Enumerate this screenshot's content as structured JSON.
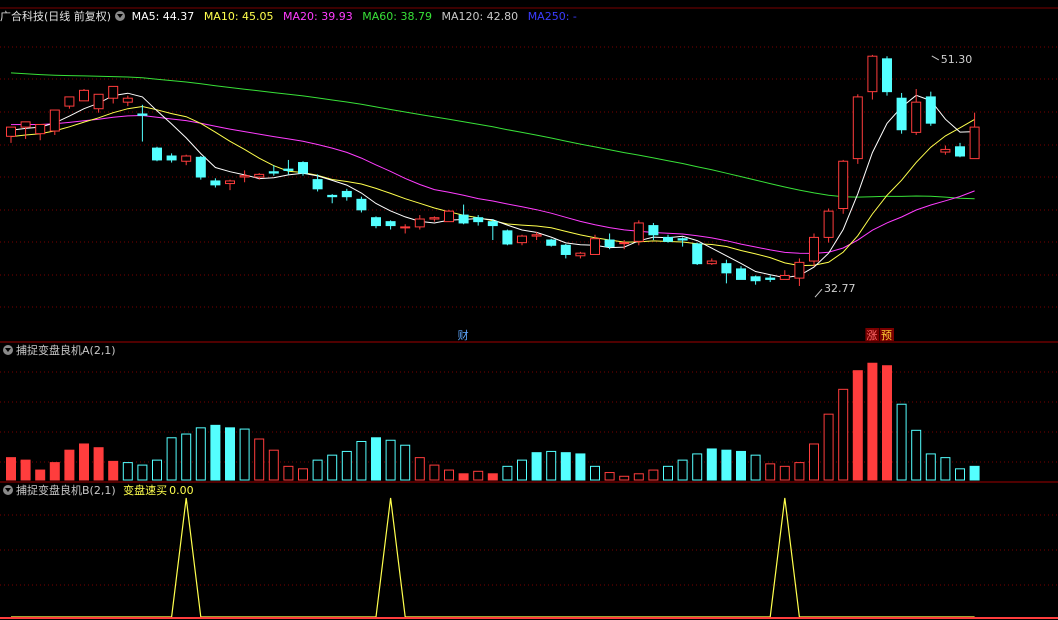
{
  "colors": {
    "up": "#ff3d3d",
    "down": "#54ffff",
    "ma5": "#ffffff",
    "ma10": "#ffff4d",
    "ma20": "#ff3dff",
    "ma60": "#38e038",
    "ma120": "#c8c8c8",
    "ma250": "#3c3cff",
    "signal": "#ffff4d",
    "grid": "#7a0000",
    "separator": "#a00000",
    "text": "#c8c8c8"
  },
  "top_header": {
    "stock_name": "广合科技(日线 前复权)",
    "ma5": "MA5: 44.37",
    "ma10": "MA10: 45.05",
    "ma20": "MA20: 39.93",
    "ma60": "MA60: 38.79",
    "ma120": "MA120: 42.80",
    "ma250": "MA250: -"
  },
  "panel_a": {
    "title": "捕捉变盘良机A(2,1)"
  },
  "panel_b": {
    "title": "捕捉变盘良机B(2,1)",
    "signal_label": "变盘速买",
    "signal_value": "0.00"
  },
  "chart_data": [
    {
      "type": "candlestick",
      "title": "广合科技(日线 前复权)",
      "ylim": [
        30.5,
        53.5
      ],
      "annotations": [
        {
          "text": "51.30",
          "x": 63,
          "value": 51.3
        },
        {
          "text": "32.77",
          "x": 55,
          "value": 32.77
        }
      ],
      "markers": [
        {
          "text": "财",
          "x": 31
        },
        {
          "text": "涨",
          "x": 59
        },
        {
          "text": "预",
          "x": 60
        }
      ],
      "series": [
        {
          "name": "OHLC",
          "ohlc": [
            [
              45.1,
              45.8,
              45.6,
              44.6
            ],
            [
              45.8,
              46.2,
              45.9,
              44.9
            ],
            [
              45.3,
              46.0,
              45.3,
              44.8
            ],
            [
              45.5,
              47.1,
              46.8,
              45.2
            ],
            [
              47.4,
              48.1,
              47.9,
              47.2
            ],
            [
              47.8,
              48.6,
              48.7,
              47.9
            ],
            [
              47.2,
              48.3,
              48.3,
              46.9
            ],
            [
              48.0,
              48.9,
              48.8,
              47.6
            ],
            [
              47.7,
              48.0,
              48.2,
              47.4
            ],
            [
              46.8,
              46.7,
              47.5,
              44.7
            ],
            [
              44.2,
              43.3,
              44.3,
              43.2
            ],
            [
              43.6,
              43.3,
              43.8,
              43.1
            ],
            [
              43.2,
              43.6,
              43.7,
              42.9
            ],
            [
              43.5,
              42.0,
              43.6,
              41.8
            ],
            [
              41.7,
              41.4,
              41.9,
              41.2
            ],
            [
              41.5,
              41.7,
              41.8,
              41.0
            ],
            [
              42.0,
              42.1,
              42.5,
              41.6
            ],
            [
              42.0,
              42.2,
              42.3,
              41.8
            ],
            [
              42.4,
              42.3,
              42.9,
              42.1
            ],
            [
              42.6,
              42.5,
              43.3,
              42.2
            ],
            [
              43.1,
              42.3,
              43.2,
              42.1
            ],
            [
              41.8,
              41.1,
              42.2,
              40.9
            ],
            [
              40.6,
              40.5,
              40.7,
              40.0
            ],
            [
              40.9,
              40.5,
              41.1,
              40.2
            ],
            [
              40.3,
              39.5,
              40.5,
              39.3
            ],
            [
              38.9,
              38.3,
              39.0,
              38.1
            ],
            [
              38.6,
              38.3,
              38.7,
              38.0
            ],
            [
              38.2,
              38.2,
              38.4,
              37.7
            ],
            [
              38.2,
              38.8,
              39.1,
              38.0
            ],
            [
              38.8,
              38.9,
              39.0,
              38.6
            ],
            [
              38.6,
              39.4,
              39.5,
              38.6
            ],
            [
              39.1,
              38.5,
              39.9,
              38.4
            ],
            [
              38.9,
              38.6,
              39.1,
              38.3
            ],
            [
              38.6,
              38.3,
              38.8,
              37.2
            ],
            [
              37.9,
              36.9,
              38.0,
              36.8
            ],
            [
              37.0,
              37.5,
              37.6,
              36.8
            ],
            [
              37.5,
              37.6,
              37.8,
              37.2
            ],
            [
              37.2,
              36.8,
              37.3,
              36.7
            ],
            [
              36.8,
              36.1,
              36.9,
              35.8
            ],
            [
              36.0,
              36.2,
              36.3,
              35.8
            ],
            [
              36.1,
              37.3,
              37.6,
              36.1
            ],
            [
              37.2,
              36.7,
              37.7,
              36.5
            ],
            [
              37.0,
              37.0,
              37.2,
              36.5
            ],
            [
              37.1,
              38.5,
              38.7,
              36.8
            ],
            [
              38.3,
              37.6,
              38.5,
              37.2
            ],
            [
              37.4,
              37.1,
              37.6,
              37.0
            ],
            [
              37.3,
              37.2,
              37.4,
              36.7
            ],
            [
              36.9,
              35.4,
              37.0,
              35.3
            ],
            [
              35.4,
              35.6,
              35.8,
              35.3
            ],
            [
              35.4,
              34.7,
              35.7,
              33.9
            ],
            [
              35.0,
              34.2,
              35.2,
              34.2
            ],
            [
              34.4,
              34.1,
              34.5,
              33.8
            ],
            [
              34.3,
              34.2,
              34.5,
              34.0
            ],
            [
              34.2,
              34.5,
              34.9,
              34.2
            ],
            [
              34.3,
              35.5,
              35.8,
              33.7
            ],
            [
              35.6,
              37.4,
              37.7,
              35.2
            ],
            [
              37.4,
              39.4,
              39.6,
              37.0
            ],
            [
              39.6,
              43.2,
              43.3,
              39.2
            ],
            [
              43.4,
              48.1,
              48.3,
              43.0
            ],
            [
              48.5,
              51.2,
              51.3,
              47.9
            ],
            [
              51.0,
              48.5,
              51.2,
              48.2
            ],
            [
              48.0,
              45.6,
              48.4,
              45.3
            ],
            [
              45.4,
              47.7,
              48.7,
              45.2
            ],
            [
              48.1,
              46.1,
              48.5,
              45.9
            ],
            [
              43.9,
              44.1,
              44.4,
              43.7
            ],
            [
              44.3,
              43.6,
              44.6,
              43.5
            ],
            [
              43.4,
              45.8,
              46.9,
              43.4
            ]
          ]
        }
      ]
    },
    {
      "type": "bar",
      "title": "捕捉变盘良机A(2,1)",
      "series": [
        {
          "name": "捕捉变盘良机A",
          "values": [
            1.8,
            1.6,
            0.8,
            1.4,
            2.4,
            2.9,
            2.6,
            1.5,
            1.4,
            1.2,
            1.6,
            3.4,
            3.7,
            4.2,
            4.4,
            4.2,
            4.1,
            3.3,
            2.4,
            1.1,
            0.9,
            1.6,
            2.0,
            2.3,
            3.1,
            3.4,
            3.2,
            2.8,
            1.8,
            1.2,
            0.8,
            0.5,
            0.7,
            0.5,
            1.1,
            1.6,
            2.2,
            2.3,
            2.2,
            2.1,
            1.1,
            0.6,
            0.3,
            0.5,
            0.8,
            1.1,
            1.6,
            2.1,
            2.5,
            2.4,
            2.3,
            2.0,
            1.3,
            1.1,
            1.4,
            2.9,
            5.3,
            7.3,
            8.8,
            9.4,
            9.2,
            6.1,
            4.0,
            2.1,
            1.8,
            0.9,
            1.1
          ],
          "colors": [
            "up",
            "up",
            "up",
            "up",
            "up",
            "up",
            "up",
            "up",
            "down",
            "down",
            "down",
            "down",
            "down",
            "down",
            "down",
            "down",
            "down",
            "up",
            "up",
            "up",
            "up",
            "down",
            "down",
            "down",
            "down",
            "down",
            "down",
            "down",
            "up",
            "up",
            "up",
            "up",
            "up",
            "up",
            "down",
            "down",
            "down",
            "down",
            "down",
            "down",
            "down",
            "up",
            "up",
            "up",
            "up",
            "down",
            "down",
            "down",
            "down",
            "down",
            "down",
            "down",
            "up",
            "up",
            "up",
            "up",
            "up",
            "up",
            "up",
            "up",
            "up",
            "down",
            "down",
            "down",
            "down",
            "down",
            "down"
          ],
          "filled": [
            true,
            true,
            true,
            true,
            true,
            true,
            true,
            true,
            false,
            false,
            false,
            false,
            false,
            false,
            true,
            true,
            false,
            false,
            false,
            false,
            false,
            false,
            false,
            false,
            false,
            true,
            false,
            false,
            false,
            false,
            false,
            true,
            false,
            true,
            false,
            false,
            true,
            false,
            true,
            true,
            false,
            false,
            false,
            false,
            false,
            false,
            false,
            false,
            true,
            true,
            true,
            false,
            false,
            false,
            false,
            false,
            false,
            false,
            true,
            true,
            true,
            false,
            false,
            false,
            false,
            false,
            true
          ]
        }
      ]
    },
    {
      "type": "line",
      "title": "捕捉变盘良机B(2,1)",
      "ylim": [
        0,
        1.1
      ],
      "series": [
        {
          "name": "变盘速买",
          "values": [
            0,
            0,
            0,
            0,
            0,
            0,
            0,
            0,
            0,
            0,
            0,
            0,
            1,
            0,
            0,
            0,
            0,
            0,
            0,
            0,
            0,
            0,
            0,
            0,
            0,
            0,
            1,
            0,
            0,
            0,
            0,
            0,
            0,
            0,
            0,
            0,
            0,
            0,
            0,
            0,
            0,
            0,
            0,
            0,
            0,
            0,
            0,
            0,
            0,
            0,
            0,
            0,
            0,
            1,
            0,
            0,
            0,
            0,
            0,
            0,
            0,
            0,
            0,
            0,
            0,
            0,
            0
          ]
        }
      ]
    }
  ]
}
